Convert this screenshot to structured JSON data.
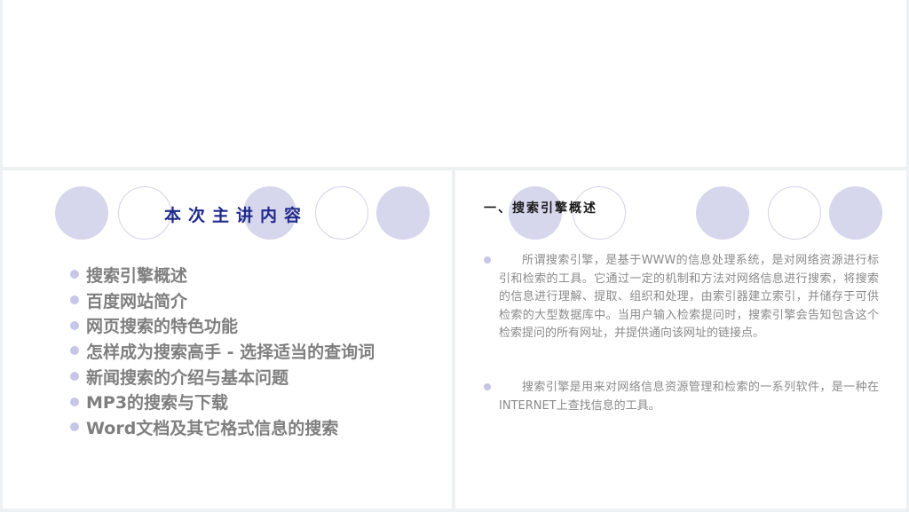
{
  "left_slide": {
    "title": "本次主讲内容",
    "agenda": [
      "搜索引擎概述",
      "百度网站简介",
      "网页搜索的特色功能",
      "怎样成为搜索高手 - 选择适当的查询词",
      "新闻搜索的介绍与基本问题",
      "MP3的搜索与下载",
      "Word文档及其它格式信息的搜索"
    ]
  },
  "right_slide": {
    "title": "一、搜索引擎概述",
    "paragraphs": [
      "所谓搜索引擎，是基于WWW的信息处理系统，是对网络资源进行标引和检索的工具。它通过一定的机制和方法对网络信息进行搜索，将搜索的信息进行理解、提取、组织和处理，由索引器建立索引，并储存于可供检索的大型数据库中。当用户输入检索提问时，搜索引擎会告知包含这个检索提问的所有网址，并提供通向该网址的链接点。",
      "搜索引擎是用来对网络信息资源管理和检索的一系列软件，是一种在INTERNET上查找信息的工具。"
    ]
  },
  "colors": {
    "circle_fill": "#d6d6ec",
    "circle_border": "#d3d3e6",
    "title_blue": "#1f2a8c",
    "agenda_text": "#7f7f7f",
    "body_text": "#8a8a8a"
  }
}
